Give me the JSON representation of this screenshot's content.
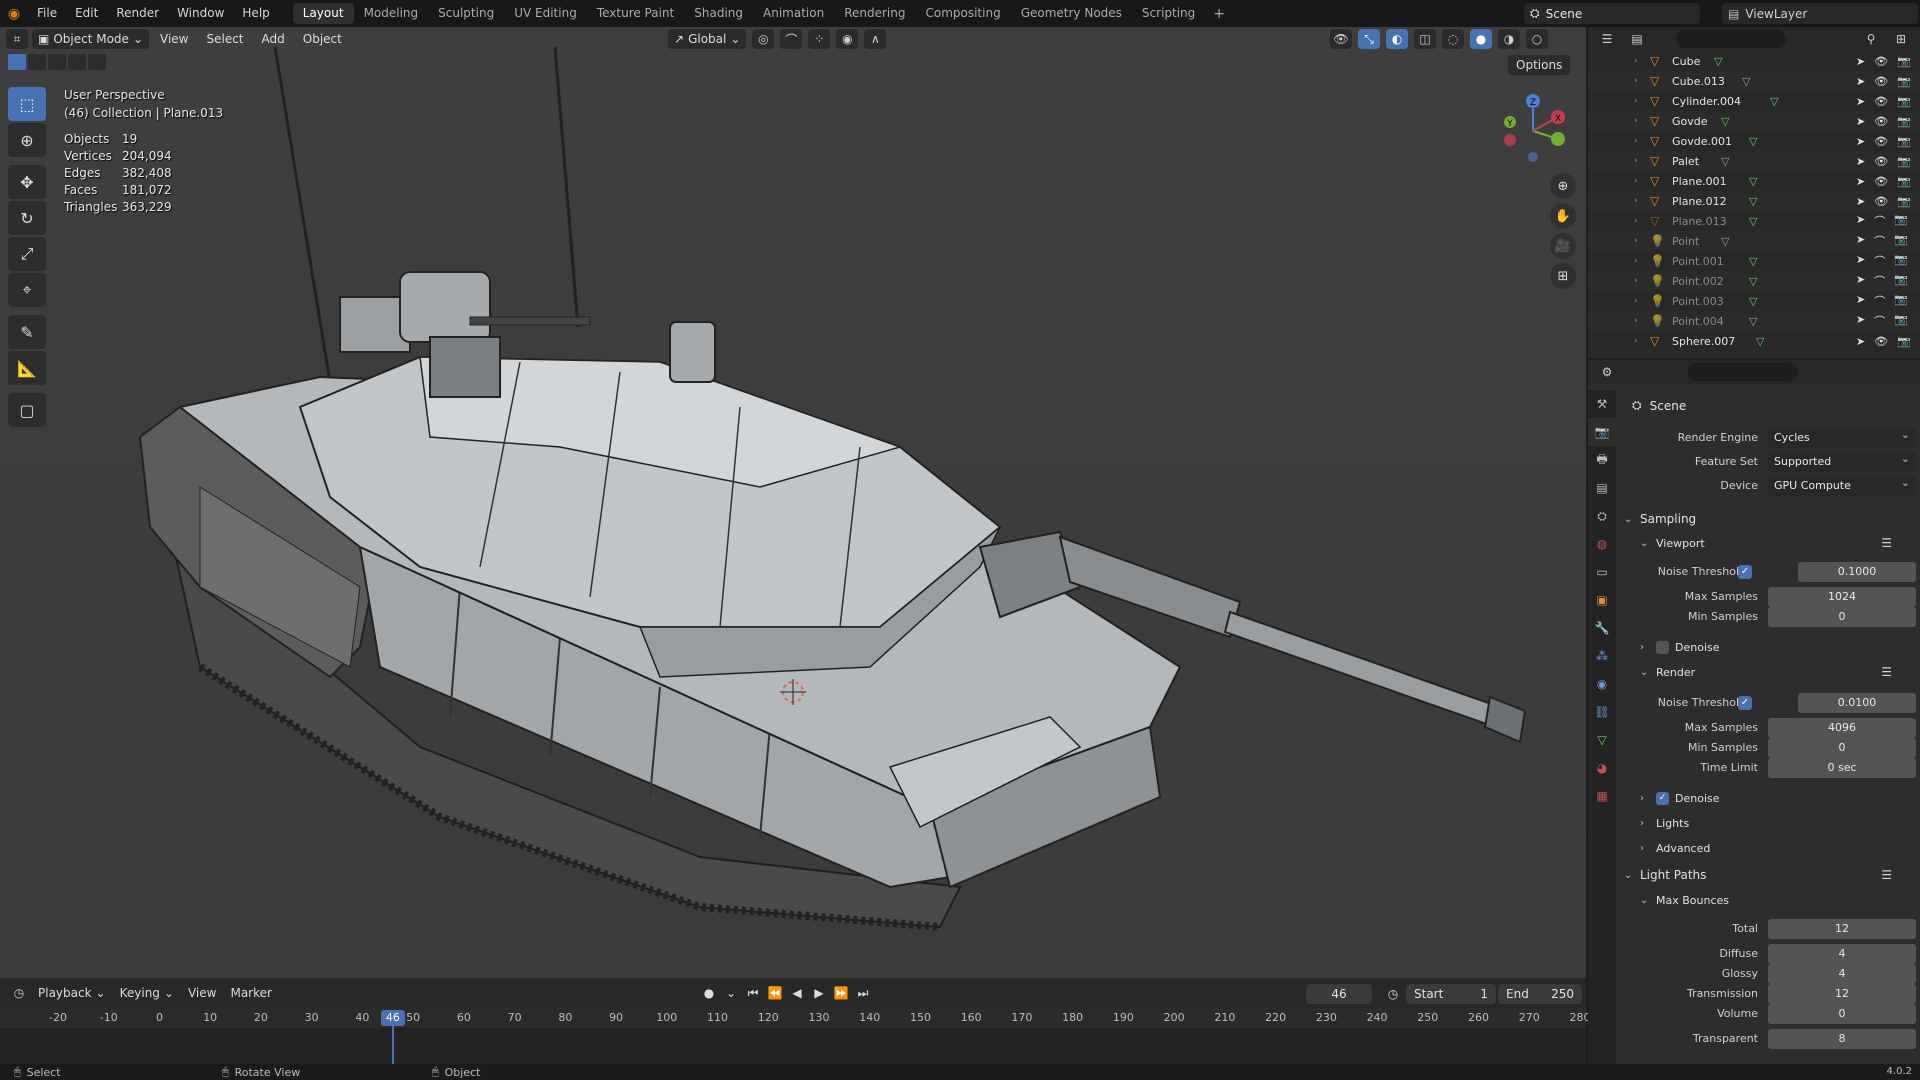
{
  "menu": [
    "File",
    "Edit",
    "Render",
    "Window",
    "Help"
  ],
  "workspaces": [
    "Layout",
    "Modeling",
    "Sculpting",
    "UV Editing",
    "Texture Paint",
    "Shading",
    "Animation",
    "Rendering",
    "Compositing",
    "Geometry Nodes",
    "Scripting"
  ],
  "workspace_add": "+",
  "scene": "Scene",
  "view_layer": "ViewLayer",
  "viewport": {
    "mode": "Object Mode",
    "menus": [
      "View",
      "Select",
      "Add",
      "Object"
    ],
    "transform": "Global",
    "options": "Options",
    "perspective": "User Perspective",
    "collection": "(46) Collection | Plane.013",
    "stats": [
      {
        "k": "Objects",
        "v": "19"
      },
      {
        "k": "Vertices",
        "v": "204,094"
      },
      {
        "k": "Edges",
        "v": "382,408"
      },
      {
        "k": "Faces",
        "v": "181,072"
      },
      {
        "k": "Triangles",
        "v": "363,229"
      }
    ],
    "gizmo": {
      "x": "X",
      "y": "Y",
      "z": "Z"
    }
  },
  "outliner": [
    {
      "name": "Cube",
      "icon": "mesh-object",
      "dim": false
    },
    {
      "name": "Cube.013",
      "icon": "mesh-object",
      "dim": false
    },
    {
      "name": "Cylinder.004",
      "icon": "mesh-object",
      "dim": false
    },
    {
      "name": "Govde",
      "icon": "mesh-object",
      "dim": false
    },
    {
      "name": "Govde.001",
      "icon": "mesh-object",
      "dim": false
    },
    {
      "name": "Palet",
      "icon": "mesh-object",
      "dim": false
    },
    {
      "name": "Plane.001",
      "icon": "mesh-object",
      "dim": false
    },
    {
      "name": "Plane.012",
      "icon": "mesh-object",
      "dim": false
    },
    {
      "name": "Plane.013",
      "icon": "mesh-object",
      "dim": true
    },
    {
      "name": "Point",
      "icon": "light-object",
      "dim": true
    },
    {
      "name": "Point.001",
      "icon": "light-object",
      "dim": true
    },
    {
      "name": "Point.002",
      "icon": "light-object",
      "dim": true
    },
    {
      "name": "Point.003",
      "icon": "light-object",
      "dim": true
    },
    {
      "name": "Point.004",
      "icon": "light-object",
      "dim": true
    },
    {
      "name": "Sphere.007",
      "icon": "mesh-object",
      "dim": false
    }
  ],
  "properties": {
    "context": "Scene",
    "render_engine": {
      "label": "Render Engine",
      "value": "Cycles"
    },
    "feature_set": {
      "label": "Feature Set",
      "value": "Supported"
    },
    "device": {
      "label": "Device",
      "value": "GPU Compute"
    },
    "sampling": "Sampling",
    "viewport_panel": "Viewport",
    "viewport_noise_threshold": {
      "label": "Noise Threshold",
      "value": "0.1000"
    },
    "viewport_max_samples": {
      "label": "Max Samples",
      "value": "1024"
    },
    "viewport_min_samples": {
      "label": "Min Samples",
      "value": "0"
    },
    "viewport_denoise": "Denoise",
    "render_panel": "Render",
    "render_noise_threshold": {
      "label": "Noise Threshold",
      "value": "0.0100"
    },
    "render_max_samples": {
      "label": "Max Samples",
      "value": "4096"
    },
    "render_min_samples": {
      "label": "Min Samples",
      "value": "0"
    },
    "render_time_limit": {
      "label": "Time Limit",
      "value": "0 sec"
    },
    "render_denoise": "Denoise",
    "lights": "Lights",
    "advanced": "Advanced",
    "light_paths": "Light Paths",
    "max_bounces": "Max Bounces",
    "total": {
      "label": "Total",
      "value": "12"
    },
    "diffuse": {
      "label": "Diffuse",
      "value": "4"
    },
    "glossy": {
      "label": "Glossy",
      "value": "4"
    },
    "transmission": {
      "label": "Transmission",
      "value": "12"
    },
    "volume": {
      "label": "Volume",
      "value": "0"
    },
    "transparent": {
      "label": "Transparent",
      "value": "8"
    }
  },
  "timeline": {
    "menus": [
      "Playback",
      "Keying",
      "View",
      "Marker"
    ],
    "current_frame": "46",
    "start_label": "Start",
    "start": "1",
    "end_label": "End",
    "end": "250",
    "ticks": [
      "-20",
      "-10",
      "0",
      "10",
      "20",
      "30",
      "40",
      "50",
      "60",
      "70",
      "80",
      "90",
      "100",
      "110",
      "120",
      "130",
      "140",
      "150",
      "160",
      "170",
      "180",
      "190",
      "200",
      "210",
      "220",
      "230",
      "240",
      "250",
      "260",
      "270",
      "280"
    ]
  },
  "status": {
    "select": "Select",
    "rotate": "Rotate View",
    "object": "Object",
    "version": "4.0.2"
  }
}
